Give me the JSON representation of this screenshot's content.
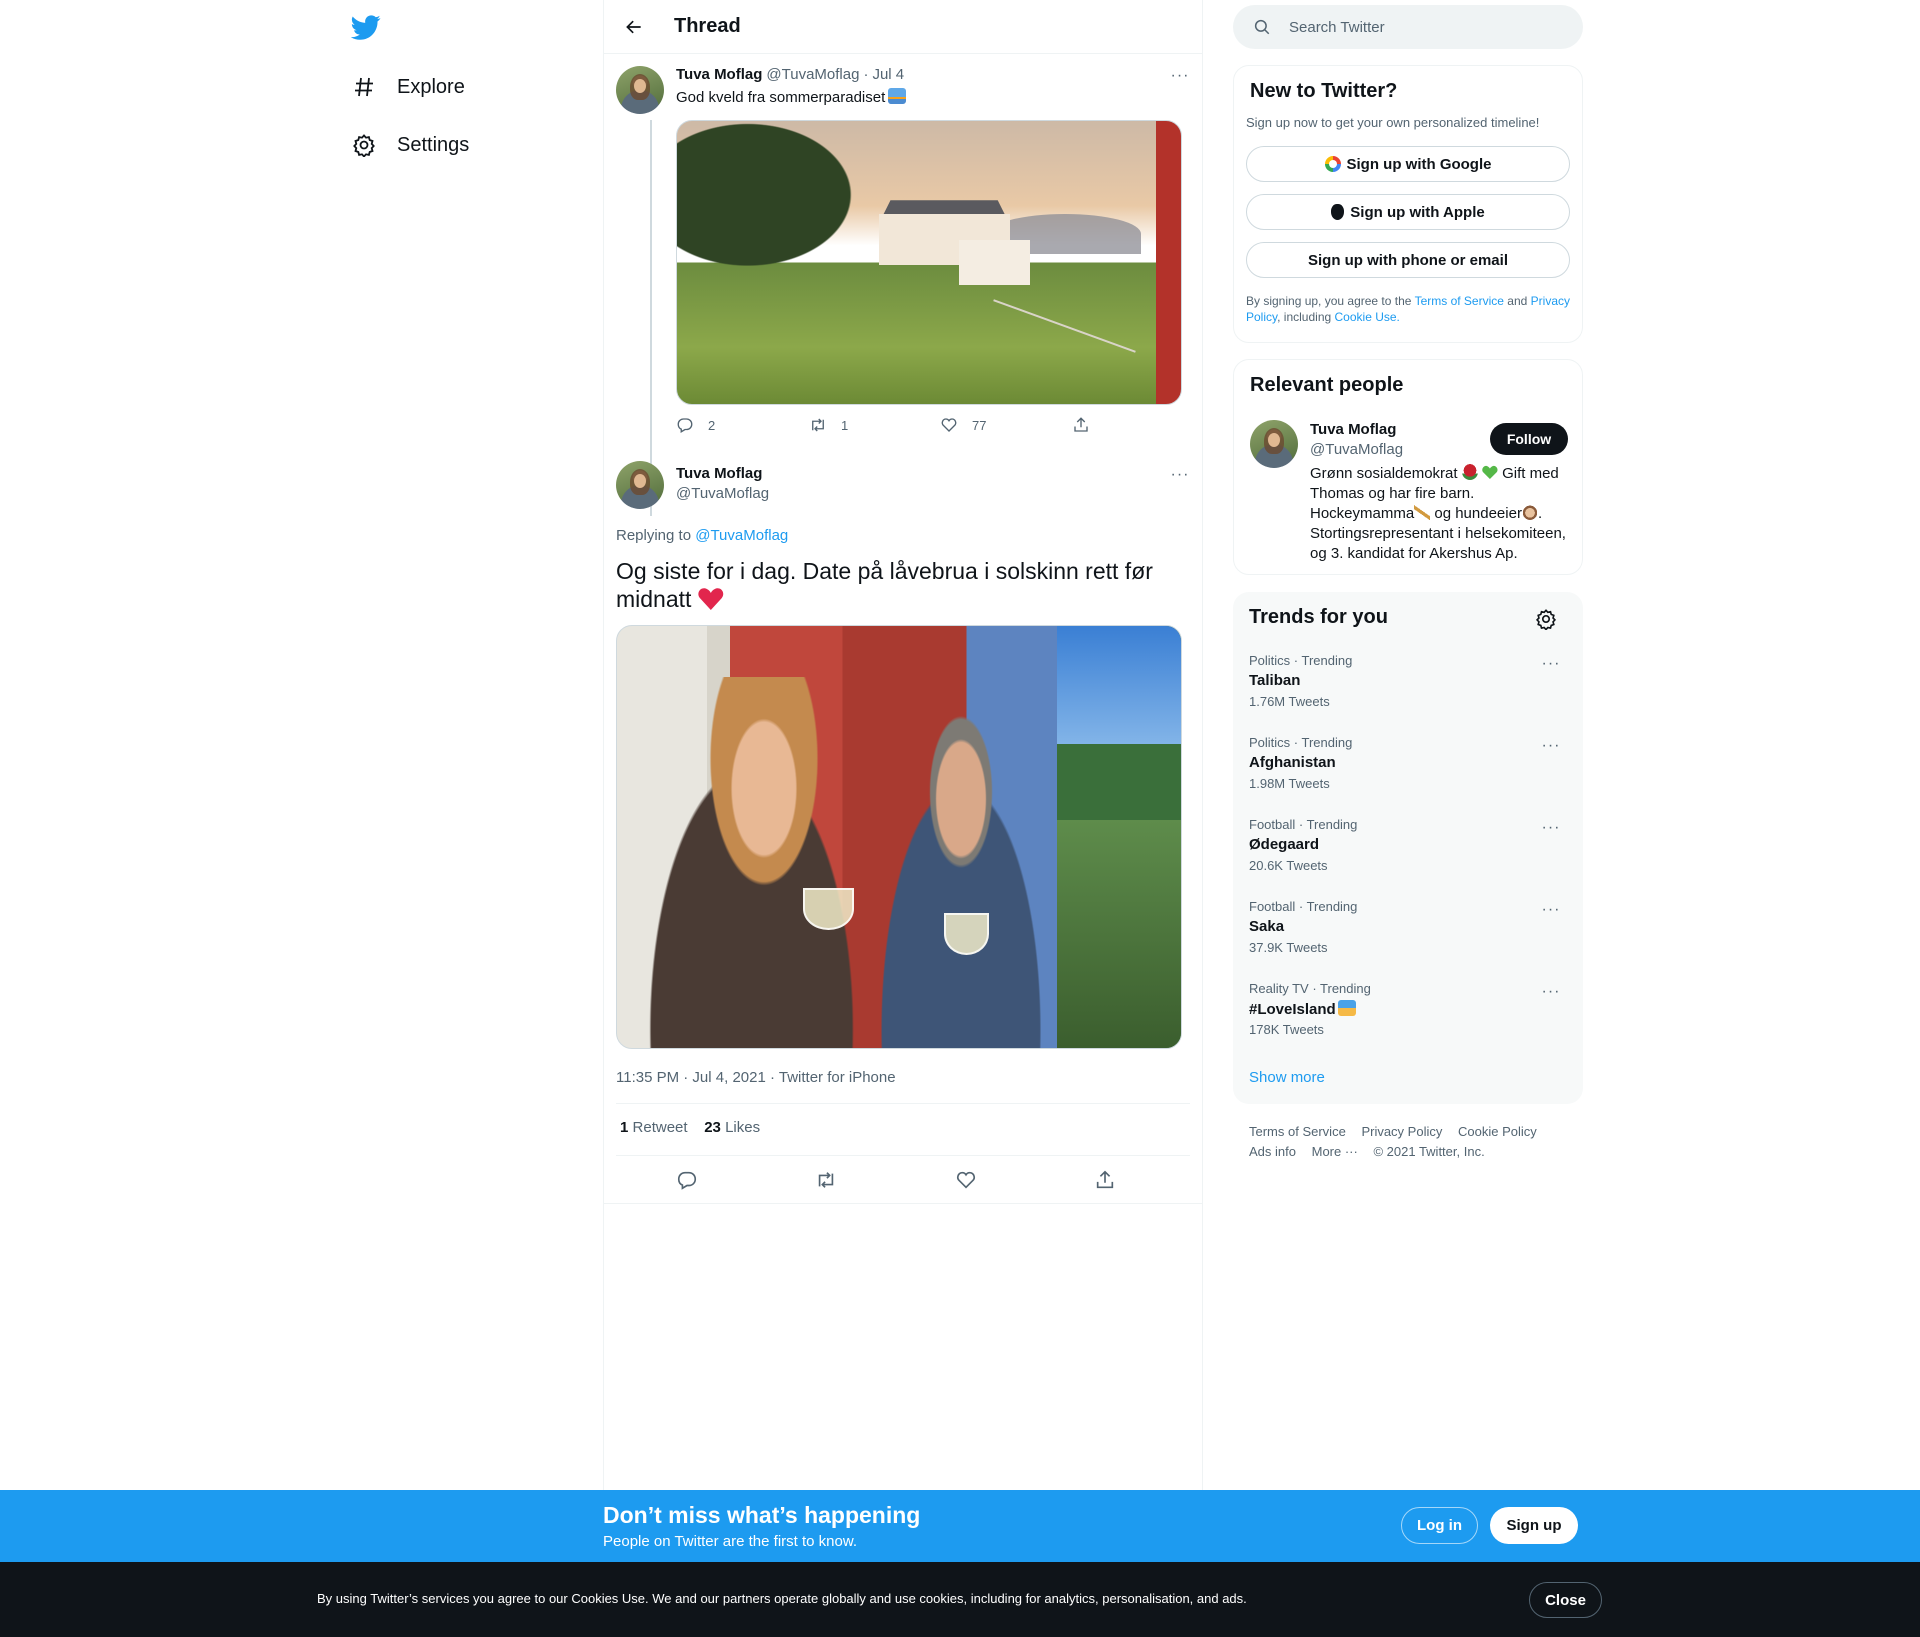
{
  "nav": {
    "logo": "twitter-bird-icon",
    "items": [
      {
        "label": "Explore",
        "icon": "hashtag-icon"
      },
      {
        "label": "Settings",
        "icon": "gear-icon"
      }
    ]
  },
  "thread": {
    "title": "Thread",
    "first_tweet": {
      "name": "Tuva Moflag",
      "handle": "@TuvaMoflag",
      "separator": "·",
      "date": "Jul 4",
      "text": "God kveld fra sommerparadiset",
      "replies": "2",
      "retweets": "1",
      "likes": "77"
    },
    "main_tweet": {
      "name": "Tuva Moflag",
      "handle": "@TuvaMoflag",
      "replying_prefix": "Replying to",
      "replying_to": "@TuvaMoflag",
      "text": "Og siste for i dag. Date på låvebrua i solskinn rett før midnatt",
      "meta": "11:35 PM · Jul 4, 2021 · Twitter for iPhone",
      "retweet_count": "1",
      "retweet_label": "Retweet",
      "like_count": "23",
      "like_label": "Likes"
    }
  },
  "search": {
    "placeholder": "Search Twitter"
  },
  "signup": {
    "title": "New to Twitter?",
    "subtitle": "Sign up now to get your own personalized timeline!",
    "google": "Sign up with Google",
    "apple": "Sign up with Apple",
    "phone": "Sign up with phone or email",
    "legal_1": "By signing up, you agree to the",
    "terms": "Terms of Service",
    "legal_2": "and",
    "privacy": "Privacy Policy",
    "legal_3": ", including",
    "cookie": "Cookie Use."
  },
  "relevant": {
    "title": "Relevant people",
    "name": "Tuva Moflag",
    "handle": "@TuvaMoflag",
    "follow": "Follow",
    "bio_1": "Grønn sosialdemokrat",
    "bio_2": "Gift med Thomas og har fire barn. Hockeymamma",
    "bio_3": "og hundeeier",
    "bio_4": ". Stortingsrepresentant i helsekomiteen, og 3. kandidat for Akershus Ap."
  },
  "trends": {
    "title": "Trends for you",
    "items": [
      {
        "category": "Politics · Trending",
        "name": "Taliban",
        "count": "1.76M Tweets"
      },
      {
        "category": "Politics · Trending",
        "name": "Afghanistan",
        "count": "1.98M Tweets"
      },
      {
        "category": "Football · Trending",
        "name": "Ødegaard",
        "count": "20.6K Tweets"
      },
      {
        "category": "Football · Trending",
        "name": "Saka",
        "count": "37.9K Tweets"
      },
      {
        "category": "Reality TV · Trending",
        "name": "#LoveIsland",
        "count": "178K Tweets"
      }
    ],
    "show_more": "Show more"
  },
  "footer": {
    "links": [
      "Terms of Service",
      "Privacy Policy",
      "Cookie Policy",
      "Ads info",
      "More ···",
      "© 2021 Twitter, Inc."
    ]
  },
  "banner": {
    "title": "Don’t miss what’s happening",
    "subtitle": "People on Twitter are the first to know.",
    "login": "Log in",
    "signup": "Sign up"
  },
  "cookie_bar": {
    "text": "By using Twitter’s services you agree to our Cookies Use. We and our partners operate globally and use cookies, including for analytics, personalisation, and ads.",
    "close": "Close"
  },
  "colors": {
    "accent": "#1d9bf0",
    "text": "#0f1419",
    "muted": "#536471",
    "border": "#eff3f4",
    "dark": "#0f1419"
  }
}
